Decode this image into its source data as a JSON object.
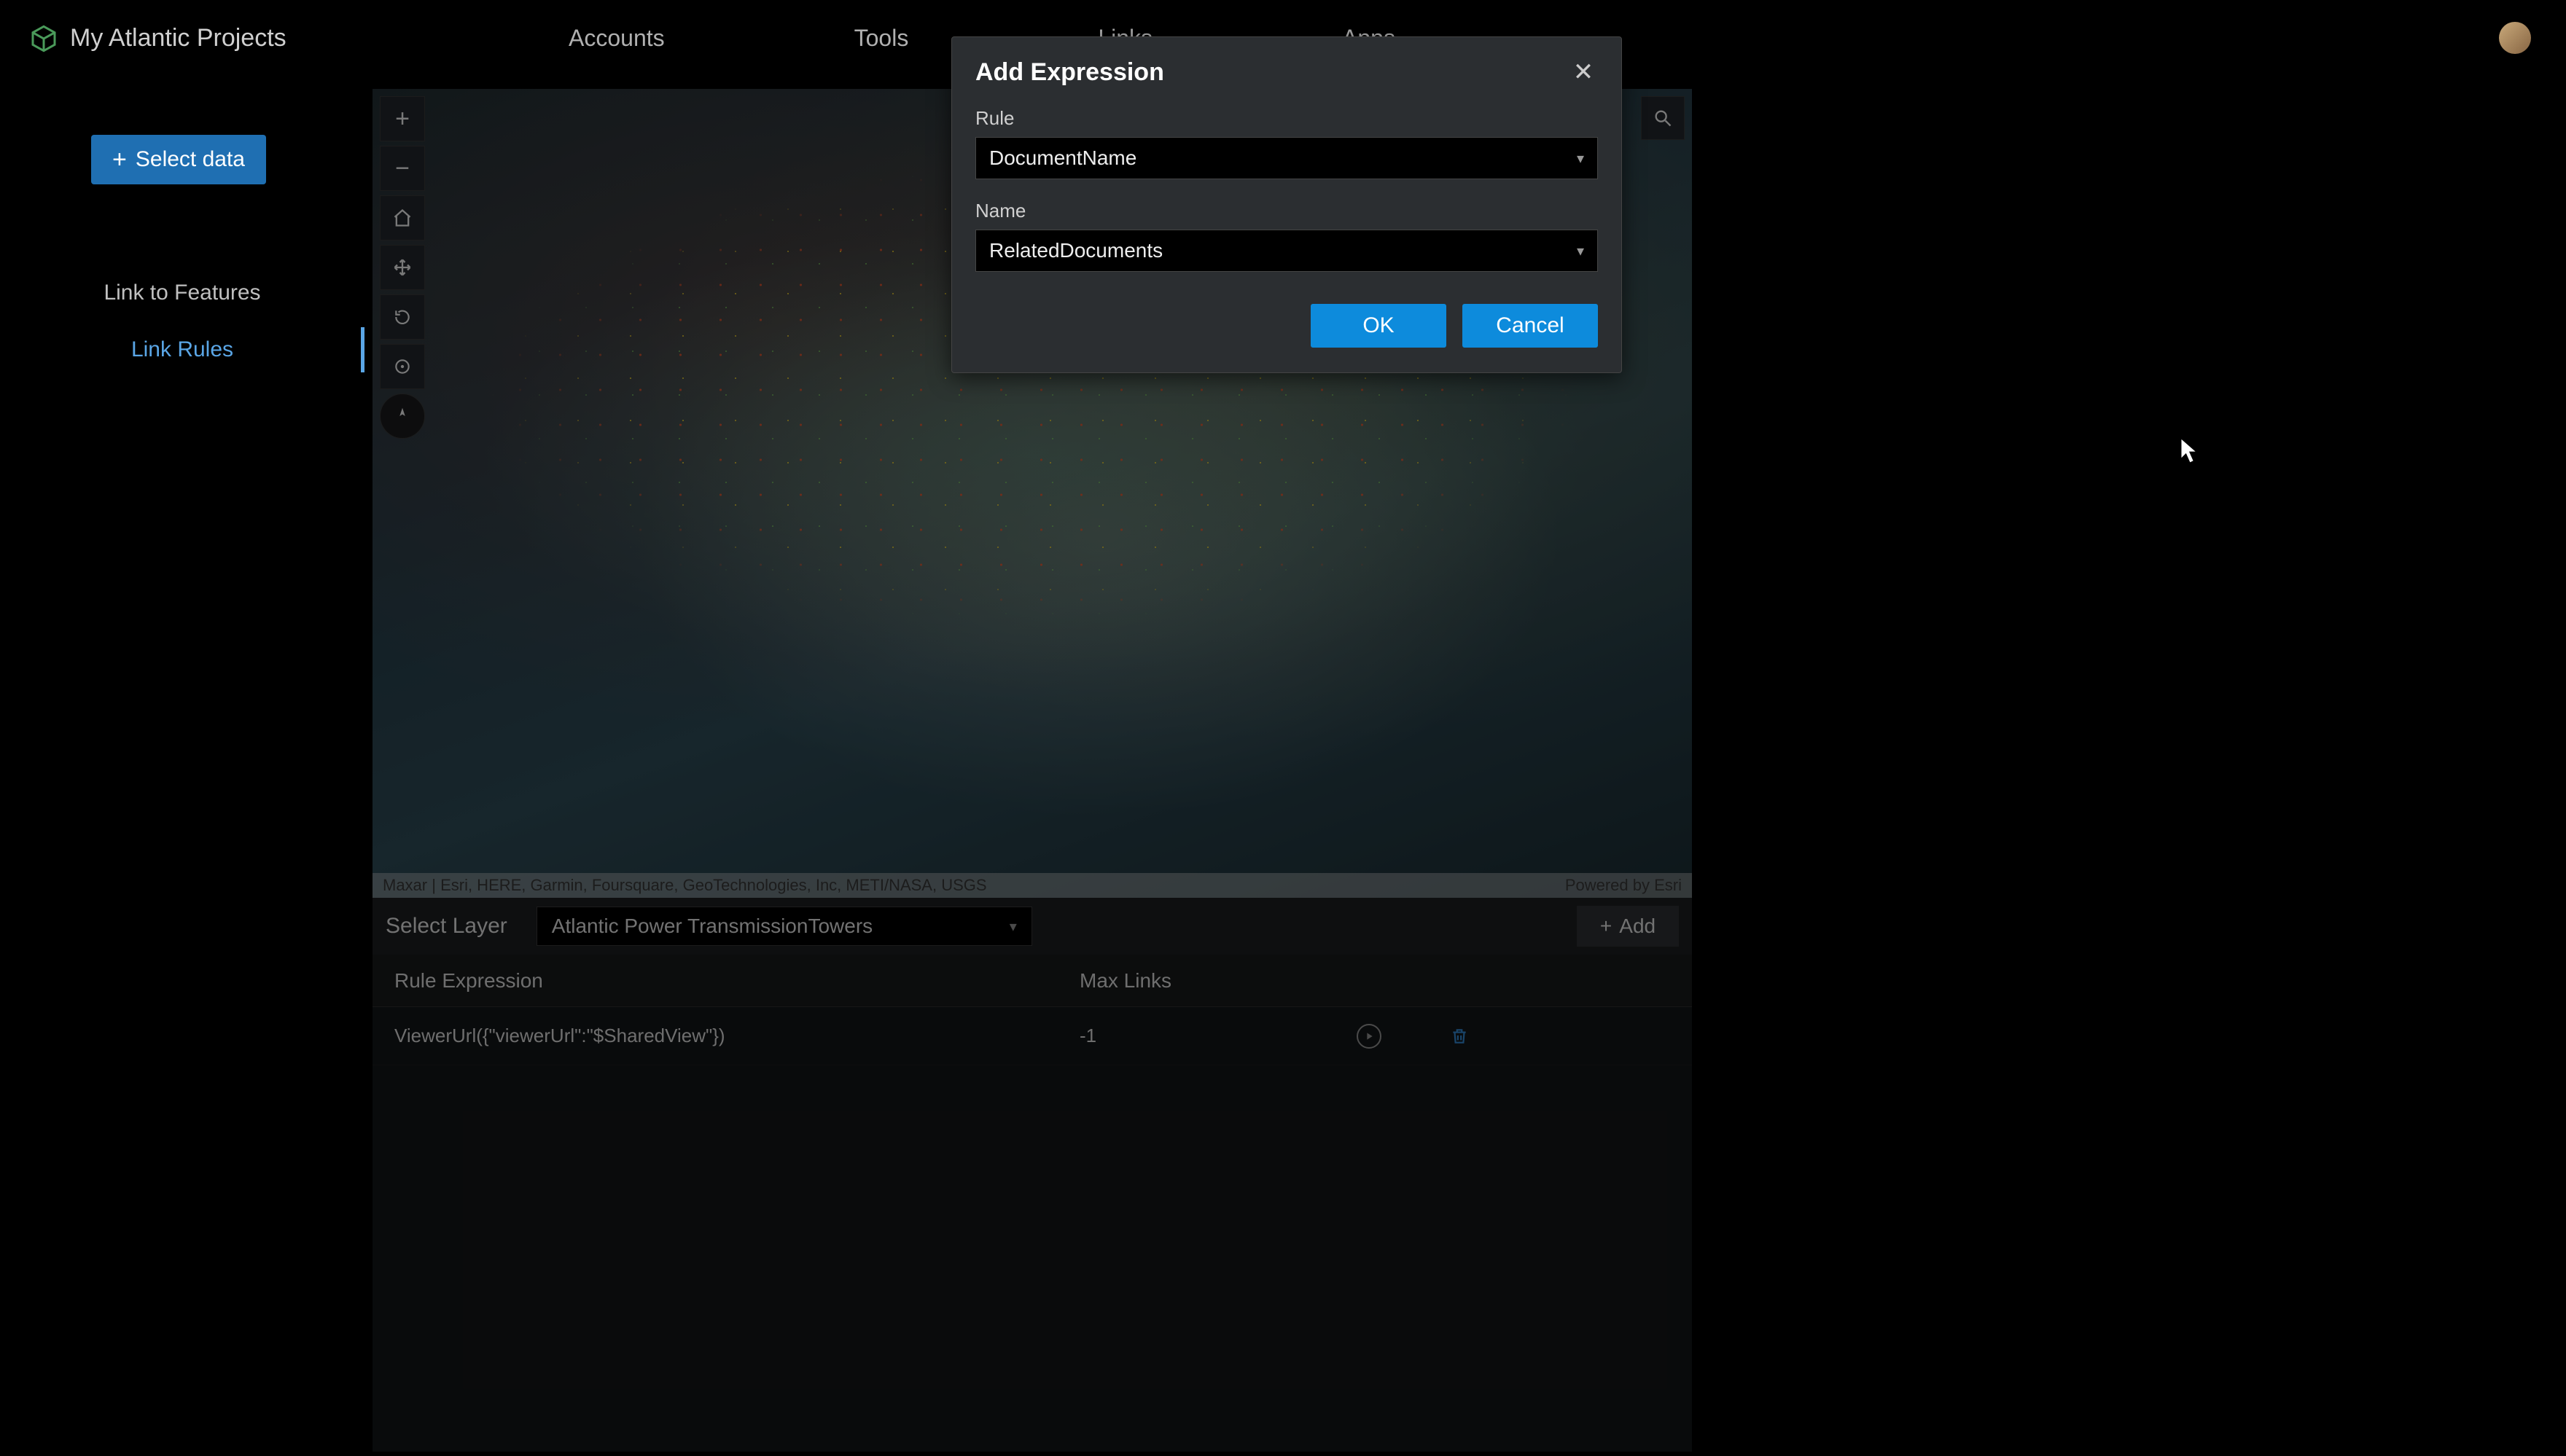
{
  "header": {
    "title": "My Atlantic Projects",
    "nav": [
      "Accounts",
      "Tools",
      "Links",
      "Apps"
    ]
  },
  "sidebar": {
    "select_data": "Select data",
    "links": [
      {
        "label": "Link to Features",
        "active": false
      },
      {
        "label": "Link Rules",
        "active": true
      }
    ]
  },
  "map": {
    "attribution_left": "Maxar | Esri, HERE, Garmin, Foursquare, GeoTechnologies, Inc, METI/NASA, USGS",
    "attribution_right": "Powered by Esri"
  },
  "bottom_panel": {
    "select_layer_label": "Select Layer",
    "layer": "Atlantic Power TransmissionTowers",
    "add_label": "Add",
    "headers": {
      "rule": "Rule Expression",
      "maxlinks": "Max Links"
    },
    "rows": [
      {
        "rule": "ViewerUrl({\"viewerUrl\":\"$SharedView\"})",
        "maxlinks": "-1"
      }
    ]
  },
  "dialog": {
    "title": "Add Expression",
    "rule_label": "Rule",
    "rule_value": "DocumentName",
    "name_label": "Name",
    "name_value": "RelatedDocuments",
    "ok": "OK",
    "cancel": "Cancel"
  }
}
